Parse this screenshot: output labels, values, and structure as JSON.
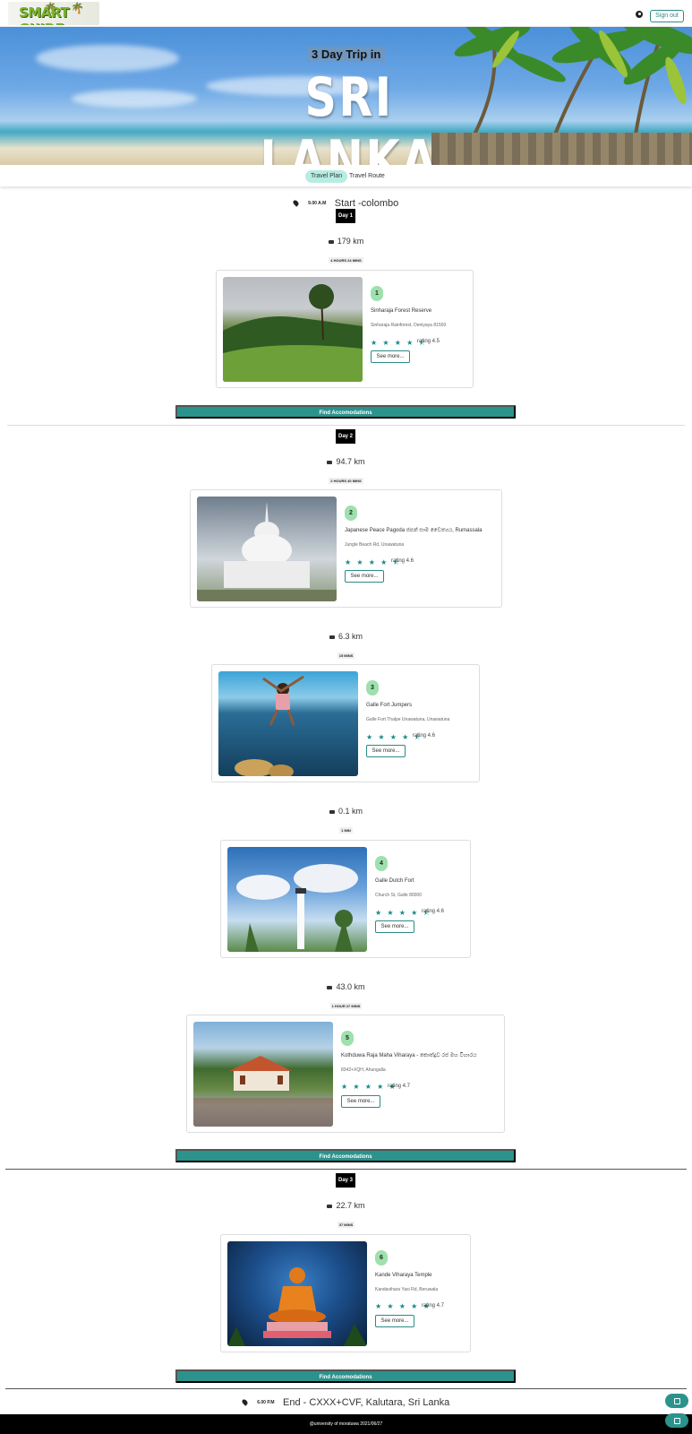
{
  "header": {
    "logo_text": "SMART GUIDE",
    "signout_label": "Sign out"
  },
  "hero": {
    "subtitle": "3 Day Trip in",
    "title": "SRI LANKA"
  },
  "tabs": [
    {
      "label": "Travel Plan",
      "active": true
    },
    {
      "label": "Travel Route",
      "active": false
    }
  ],
  "start": {
    "time": "9.00 A.M",
    "label": "Start -colombo"
  },
  "end": {
    "time": "6.00 P.M",
    "label": "End - CXXX+CVF, Kalutara, Sri Lanka"
  },
  "days": [
    {
      "label": "Day 1"
    },
    {
      "label": "Day 2"
    },
    {
      "label": "Day 3"
    }
  ],
  "legs": [
    {
      "distance": "179 km",
      "duration": "4 HOURS 24 MINS"
    },
    {
      "distance": "94.7 km",
      "duration": "2 HOURS 40 MINS"
    },
    {
      "distance": "6.3 km",
      "duration": "15 MINS"
    },
    {
      "distance": "0.1 km",
      "duration": "1 MIN"
    },
    {
      "distance": "43.0 km",
      "duration": "1 HOUR 27 MINS"
    },
    {
      "distance": "22.7 km",
      "duration": "37 MINS"
    }
  ],
  "places": [
    {
      "num": "1",
      "name": "Sinharaja Forest Reserve",
      "address": "Sinharaja Rainforest, Deniyaya 81500",
      "stars": "★ ★ ★ ★ ⯪",
      "rating": "rating 4.5",
      "rating_value": 4.5,
      "more": "See more..."
    },
    {
      "num": "2",
      "name": "Japanese Peace Pagoda ජපන් සාම චෛත්‍යය, Rumassala",
      "address": "Jungle Beach Rd, Unawatuna",
      "stars": "★ ★ ★ ★ ⯪",
      "rating": "rating 4.6",
      "rating_value": 4.6,
      "more": "See more..."
    },
    {
      "num": "3",
      "name": "Galle Fort Jumpers",
      "address": "Galle Fort Thalpe Unawatuna, Unawatuna",
      "stars": "★ ★ ★ ★ ⯪",
      "rating": "rating 4.6",
      "rating_value": 4.6,
      "more": "See more..."
    },
    {
      "num": "4",
      "name": "Galle Dutch Fort",
      "address": "Church St, Galle 80000",
      "stars": "★ ★ ★ ★ ⯪",
      "rating": "rating 4.6",
      "rating_value": 4.6,
      "more": "See more..."
    },
    {
      "num": "5",
      "name": "Kothduwa Raja Maha Viharaya - කොත්දූව රජ මහ විහාරය",
      "address": "8342+XQH, Ahungalla",
      "stars": "★ ★ ★ ★ ★",
      "rating": "rating 4.7",
      "rating_value": 4.7,
      "more": "See more..."
    },
    {
      "num": "6",
      "name": "Kande Viharaya Temple",
      "address": "Kandavihara Yasi Rd, Beruwala",
      "stars": "★ ★ ★ ★ ★",
      "rating": "rating 4.7",
      "rating_value": 4.7,
      "more": "See more..."
    }
  ],
  "accommodations_label": "Find Accomodations",
  "footer": {
    "text": "@university of moratuwa 2021/06/27"
  },
  "fabs": [
    {
      "icon": "edit-icon"
    },
    {
      "icon": "save-icon"
    }
  ],
  "colors": {
    "accent": "#2c928c",
    "badge_green": "#9ee0ae",
    "star": "#168a86"
  }
}
